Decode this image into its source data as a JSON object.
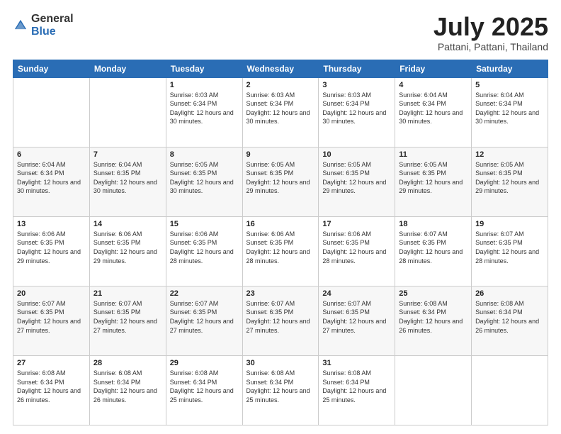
{
  "logo": {
    "general": "General",
    "blue": "Blue"
  },
  "title": {
    "month": "July 2025",
    "location": "Pattani, Pattani, Thailand"
  },
  "headers": [
    "Sunday",
    "Monday",
    "Tuesday",
    "Wednesday",
    "Thursday",
    "Friday",
    "Saturday"
  ],
  "weeks": [
    [
      {
        "day": "",
        "sunrise": "",
        "sunset": "",
        "daylight": ""
      },
      {
        "day": "",
        "sunrise": "",
        "sunset": "",
        "daylight": ""
      },
      {
        "day": "1",
        "sunrise": "Sunrise: 6:03 AM",
        "sunset": "Sunset: 6:34 PM",
        "daylight": "Daylight: 12 hours and 30 minutes."
      },
      {
        "day": "2",
        "sunrise": "Sunrise: 6:03 AM",
        "sunset": "Sunset: 6:34 PM",
        "daylight": "Daylight: 12 hours and 30 minutes."
      },
      {
        "day": "3",
        "sunrise": "Sunrise: 6:03 AM",
        "sunset": "Sunset: 6:34 PM",
        "daylight": "Daylight: 12 hours and 30 minutes."
      },
      {
        "day": "4",
        "sunrise": "Sunrise: 6:04 AM",
        "sunset": "Sunset: 6:34 PM",
        "daylight": "Daylight: 12 hours and 30 minutes."
      },
      {
        "day": "5",
        "sunrise": "Sunrise: 6:04 AM",
        "sunset": "Sunset: 6:34 PM",
        "daylight": "Daylight: 12 hours and 30 minutes."
      }
    ],
    [
      {
        "day": "6",
        "sunrise": "Sunrise: 6:04 AM",
        "sunset": "Sunset: 6:34 PM",
        "daylight": "Daylight: 12 hours and 30 minutes."
      },
      {
        "day": "7",
        "sunrise": "Sunrise: 6:04 AM",
        "sunset": "Sunset: 6:35 PM",
        "daylight": "Daylight: 12 hours and 30 minutes."
      },
      {
        "day": "8",
        "sunrise": "Sunrise: 6:05 AM",
        "sunset": "Sunset: 6:35 PM",
        "daylight": "Daylight: 12 hours and 30 minutes."
      },
      {
        "day": "9",
        "sunrise": "Sunrise: 6:05 AM",
        "sunset": "Sunset: 6:35 PM",
        "daylight": "Daylight: 12 hours and 29 minutes."
      },
      {
        "day": "10",
        "sunrise": "Sunrise: 6:05 AM",
        "sunset": "Sunset: 6:35 PM",
        "daylight": "Daylight: 12 hours and 29 minutes."
      },
      {
        "day": "11",
        "sunrise": "Sunrise: 6:05 AM",
        "sunset": "Sunset: 6:35 PM",
        "daylight": "Daylight: 12 hours and 29 minutes."
      },
      {
        "day": "12",
        "sunrise": "Sunrise: 6:05 AM",
        "sunset": "Sunset: 6:35 PM",
        "daylight": "Daylight: 12 hours and 29 minutes."
      }
    ],
    [
      {
        "day": "13",
        "sunrise": "Sunrise: 6:06 AM",
        "sunset": "Sunset: 6:35 PM",
        "daylight": "Daylight: 12 hours and 29 minutes."
      },
      {
        "day": "14",
        "sunrise": "Sunrise: 6:06 AM",
        "sunset": "Sunset: 6:35 PM",
        "daylight": "Daylight: 12 hours and 29 minutes."
      },
      {
        "day": "15",
        "sunrise": "Sunrise: 6:06 AM",
        "sunset": "Sunset: 6:35 PM",
        "daylight": "Daylight: 12 hours and 28 minutes."
      },
      {
        "day": "16",
        "sunrise": "Sunrise: 6:06 AM",
        "sunset": "Sunset: 6:35 PM",
        "daylight": "Daylight: 12 hours and 28 minutes."
      },
      {
        "day": "17",
        "sunrise": "Sunrise: 6:06 AM",
        "sunset": "Sunset: 6:35 PM",
        "daylight": "Daylight: 12 hours and 28 minutes."
      },
      {
        "day": "18",
        "sunrise": "Sunrise: 6:07 AM",
        "sunset": "Sunset: 6:35 PM",
        "daylight": "Daylight: 12 hours and 28 minutes."
      },
      {
        "day": "19",
        "sunrise": "Sunrise: 6:07 AM",
        "sunset": "Sunset: 6:35 PM",
        "daylight": "Daylight: 12 hours and 28 minutes."
      }
    ],
    [
      {
        "day": "20",
        "sunrise": "Sunrise: 6:07 AM",
        "sunset": "Sunset: 6:35 PM",
        "daylight": "Daylight: 12 hours and 27 minutes."
      },
      {
        "day": "21",
        "sunrise": "Sunrise: 6:07 AM",
        "sunset": "Sunset: 6:35 PM",
        "daylight": "Daylight: 12 hours and 27 minutes."
      },
      {
        "day": "22",
        "sunrise": "Sunrise: 6:07 AM",
        "sunset": "Sunset: 6:35 PM",
        "daylight": "Daylight: 12 hours and 27 minutes."
      },
      {
        "day": "23",
        "sunrise": "Sunrise: 6:07 AM",
        "sunset": "Sunset: 6:35 PM",
        "daylight": "Daylight: 12 hours and 27 minutes."
      },
      {
        "day": "24",
        "sunrise": "Sunrise: 6:07 AM",
        "sunset": "Sunset: 6:35 PM",
        "daylight": "Daylight: 12 hours and 27 minutes."
      },
      {
        "day": "25",
        "sunrise": "Sunrise: 6:08 AM",
        "sunset": "Sunset: 6:34 PM",
        "daylight": "Daylight: 12 hours and 26 minutes."
      },
      {
        "day": "26",
        "sunrise": "Sunrise: 6:08 AM",
        "sunset": "Sunset: 6:34 PM",
        "daylight": "Daylight: 12 hours and 26 minutes."
      }
    ],
    [
      {
        "day": "27",
        "sunrise": "Sunrise: 6:08 AM",
        "sunset": "Sunset: 6:34 PM",
        "daylight": "Daylight: 12 hours and 26 minutes."
      },
      {
        "day": "28",
        "sunrise": "Sunrise: 6:08 AM",
        "sunset": "Sunset: 6:34 PM",
        "daylight": "Daylight: 12 hours and 26 minutes."
      },
      {
        "day": "29",
        "sunrise": "Sunrise: 6:08 AM",
        "sunset": "Sunset: 6:34 PM",
        "daylight": "Daylight: 12 hours and 25 minutes."
      },
      {
        "day": "30",
        "sunrise": "Sunrise: 6:08 AM",
        "sunset": "Sunset: 6:34 PM",
        "daylight": "Daylight: 12 hours and 25 minutes."
      },
      {
        "day": "31",
        "sunrise": "Sunrise: 6:08 AM",
        "sunset": "Sunset: 6:34 PM",
        "daylight": "Daylight: 12 hours and 25 minutes."
      },
      {
        "day": "",
        "sunrise": "",
        "sunset": "",
        "daylight": ""
      },
      {
        "day": "",
        "sunrise": "",
        "sunset": "",
        "daylight": ""
      }
    ]
  ]
}
